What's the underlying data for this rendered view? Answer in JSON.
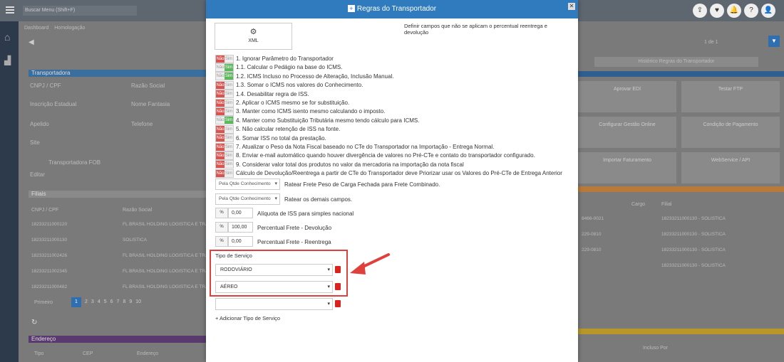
{
  "app": {
    "search_placeholder": "Buscar Menu (Shift+F)"
  },
  "tabs": [
    {
      "label": "Dashboard"
    },
    {
      "label": "Homologação"
    }
  ],
  "background": {
    "section_transportadora": "Transportadora",
    "labels": {
      "cnpj": "CNPJ / CPF",
      "razao": "Razão Social",
      "insc": "Inscrição Estadual",
      "fantasia": "Nome Fantasia",
      "apelido": "Apelido",
      "telefone": "Telefone",
      "site": "Site"
    },
    "transp_name": "Transportadora FOB",
    "edit": "Editar",
    "filiais": "Filiais",
    "filiais_cols": [
      "CNPJ / CPF",
      "Razão Social"
    ],
    "filiais_rows": [
      {
        "cnpj": "18233211000120",
        "razao": "FL BRASIL HOLDING LOGISTICA E TRANS"
      },
      {
        "cnpj": "18233211000130",
        "razao": "SOLISTICA"
      },
      {
        "cnpj": "18233211002426",
        "razao": "FL BRASIL HOLDING LOGISTICA E TRANS"
      },
      {
        "cnpj": "18233211002345",
        "razao": "FL BRASIL HOLDING LOGISTICA E TRANS"
      },
      {
        "cnpj": "18233211000482",
        "razao": "FL BRASIL HOLDING LOGISTICA E TRANS"
      }
    ],
    "pager": {
      "first": "Primeiro",
      "pages": [
        "1",
        "2",
        "3",
        "4",
        "5",
        "6",
        "7",
        "8",
        "9",
        "10"
      ]
    },
    "endereco": "Endereço",
    "end_cols": [
      "Tipo",
      "CEP",
      "Endereço"
    ],
    "page_count": "1 de 1",
    "historico": "Histórico Regras do Transportador",
    "tiles": [
      "Aprovar EDI",
      "Testar FTP",
      "Configurar Gestão Online",
      "Condição de Pagamento",
      "Importar Faturamento",
      "WebService / API"
    ],
    "right_cols": [
      "Cargo",
      "Filial"
    ],
    "right_rows": [
      "18233211000130 - SOLISTICA",
      "18233211000130 - SOLISTICA",
      "18233211000130 - SOLISTICA",
      "18233211000130 - SOLISTICA"
    ],
    "right_left": [
      "8466-0021",
      "229-0810",
      "229-0810"
    ],
    "incluso": "Incluso Por"
  },
  "modal": {
    "title": "Regras do Transportador",
    "xml_label": "XML",
    "desc": "Definir campos que não se aplicam o percentual reentrega e devolução",
    "toggle_no": "Não",
    "toggle_yes": "Sim",
    "rules": [
      {
        "text": "1. Ignorar Parâmetro do Transportador",
        "value": "no"
      },
      {
        "text": "1.1. Calcular o Pedágio na base do ICMS.",
        "value": "yes"
      },
      {
        "text": "1.2. ICMS Incluso no Processo de Alteração, Inclusão Manual.",
        "value": "yes"
      },
      {
        "text": "1.3. Somar o ICMS nos valores do Conhecimento.",
        "value": "no"
      },
      {
        "text": "1.4. Desabilitar regra de ISS.",
        "value": "no"
      },
      {
        "text": "2. Aplicar o ICMS mesmo se for substituição.",
        "value": "no"
      },
      {
        "text": "3. Manter como ICMS isento mesmo calculando o imposto.",
        "value": "no"
      },
      {
        "text": "4. Manter como Substituição Tributária mesmo tendo cálculo para ICMS.",
        "value": "yes"
      },
      {
        "text": "5. Não calcular retenção de ISS na fonte.",
        "value": "no"
      },
      {
        "text": "6. Somar ISS no total da prestação.",
        "value": "no"
      },
      {
        "text": "7. Atualizar o Peso da Nota Fiscal baseado no CTe do Transportador na Importação - Entrega Normal.",
        "value": "no"
      },
      {
        "text": "8. Enviar e-mail automático quando houver divergência de valores no Pré-CTe e contato do transportador configurado.",
        "value": "no"
      },
      {
        "text": "9. Considerar valor total dos produtos no valor da mercadoria na importação da nota fiscal",
        "value": "no"
      },
      {
        "text": "Cálculo de Devolução/Reentrega a partir de CTe do Transportador deve Priorizar usar os Valores do Pré-CTe de Entrega Anterior",
        "value": "no"
      }
    ],
    "selects": [
      {
        "value": "Pela Qtde Conhecimento",
        "label": "Ratear Frete Peso de Carga Fechada para Frete Combinado."
      },
      {
        "value": "Pela Qtde Conhecimento",
        "label": "Ratear os demais campos."
      }
    ],
    "percent_symbol": "%",
    "numbers": [
      {
        "value": "0,00",
        "label": "Alíquota de ISS para simples nacional"
      },
      {
        "value": "100,00",
        "label": "Percentual Frete - Devolução"
      },
      {
        "value": "0,00",
        "label": "Percentual Frete - Reentrega"
      }
    ],
    "service_type_label": "Tipo de Serviço",
    "services": [
      "RODOVIÁRIO",
      "AÉREO",
      ""
    ],
    "add_service": "+ Adicionar Tipo de Serviço"
  },
  "colors": {
    "header_blue": "#2f7bbd",
    "highlight_red": "#e0403c",
    "nao_red": "#d9534f",
    "sim_green": "#5cb85c"
  }
}
